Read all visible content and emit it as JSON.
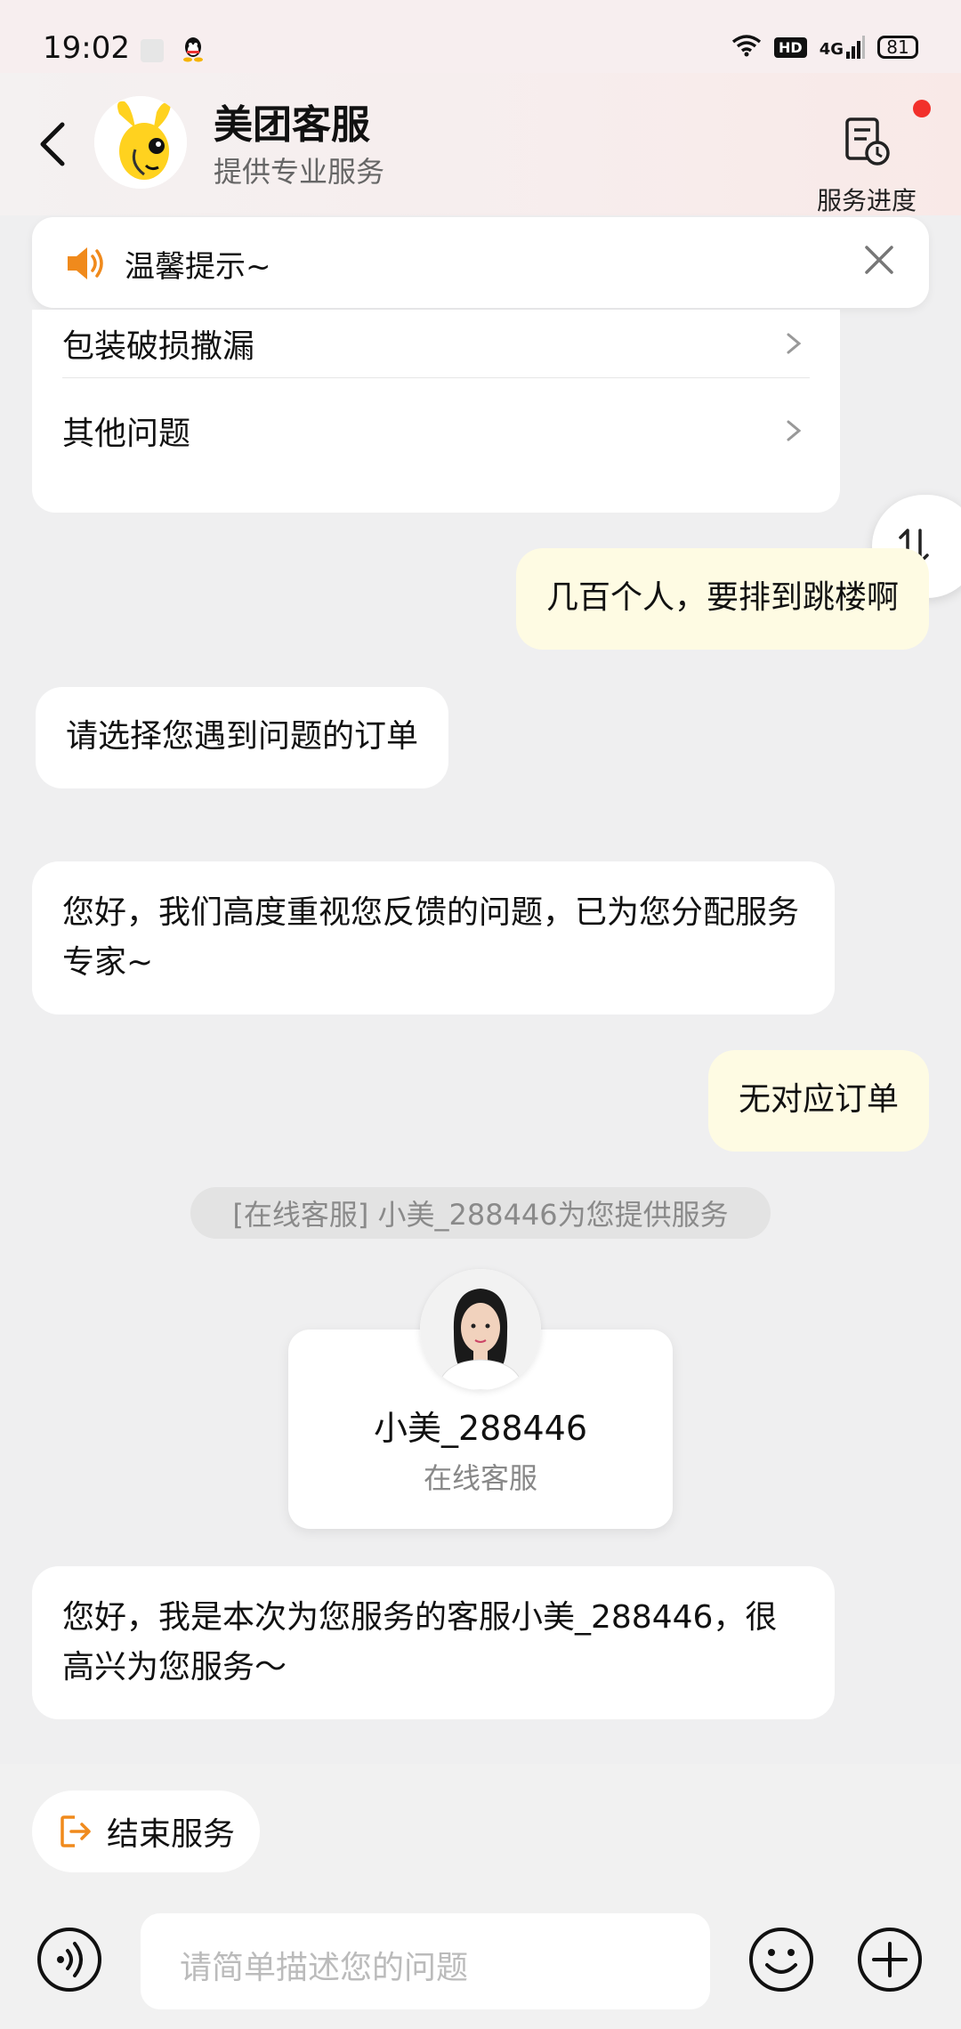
{
  "status": {
    "time": "19:02",
    "battery": "81",
    "hd": "HD",
    "network": "4G"
  },
  "header": {
    "title": "美团客服",
    "subtitle": "提供专业服务",
    "progress_label": "服务进度"
  },
  "notice": {
    "text": "温馨提示~"
  },
  "menu": {
    "items": [
      {
        "label": "包装破损撒漏"
      },
      {
        "label": "其他问题"
      }
    ]
  },
  "side_toggle": {
    "icon": "swap-vertical-icon"
  },
  "messages": [
    {
      "side": "right",
      "text": "几百个人，要排到跳楼啊"
    },
    {
      "side": "left",
      "text": "请选择您遇到问题的订单"
    },
    {
      "side": "left",
      "text": "您好，我们高度重视您反馈的问题，已为您分配服务专家~"
    },
    {
      "side": "right",
      "text": "无对应订单"
    }
  ],
  "system_notice": "[在线客服] 小美_288446为您提供服务",
  "agent": {
    "name": "小美_288446",
    "role": "在线客服"
  },
  "agent_greeting": "您好，我是本次为您服务的客服小美_288446，很高兴为您服务～",
  "bottom": {
    "end_service": "结束服务",
    "input_placeholder": "请简单描述您的问题"
  },
  "colors": {
    "accent_orange": "#f08a1c",
    "bubble_right": "#fefbe3",
    "red_dot": "#f2302b"
  }
}
